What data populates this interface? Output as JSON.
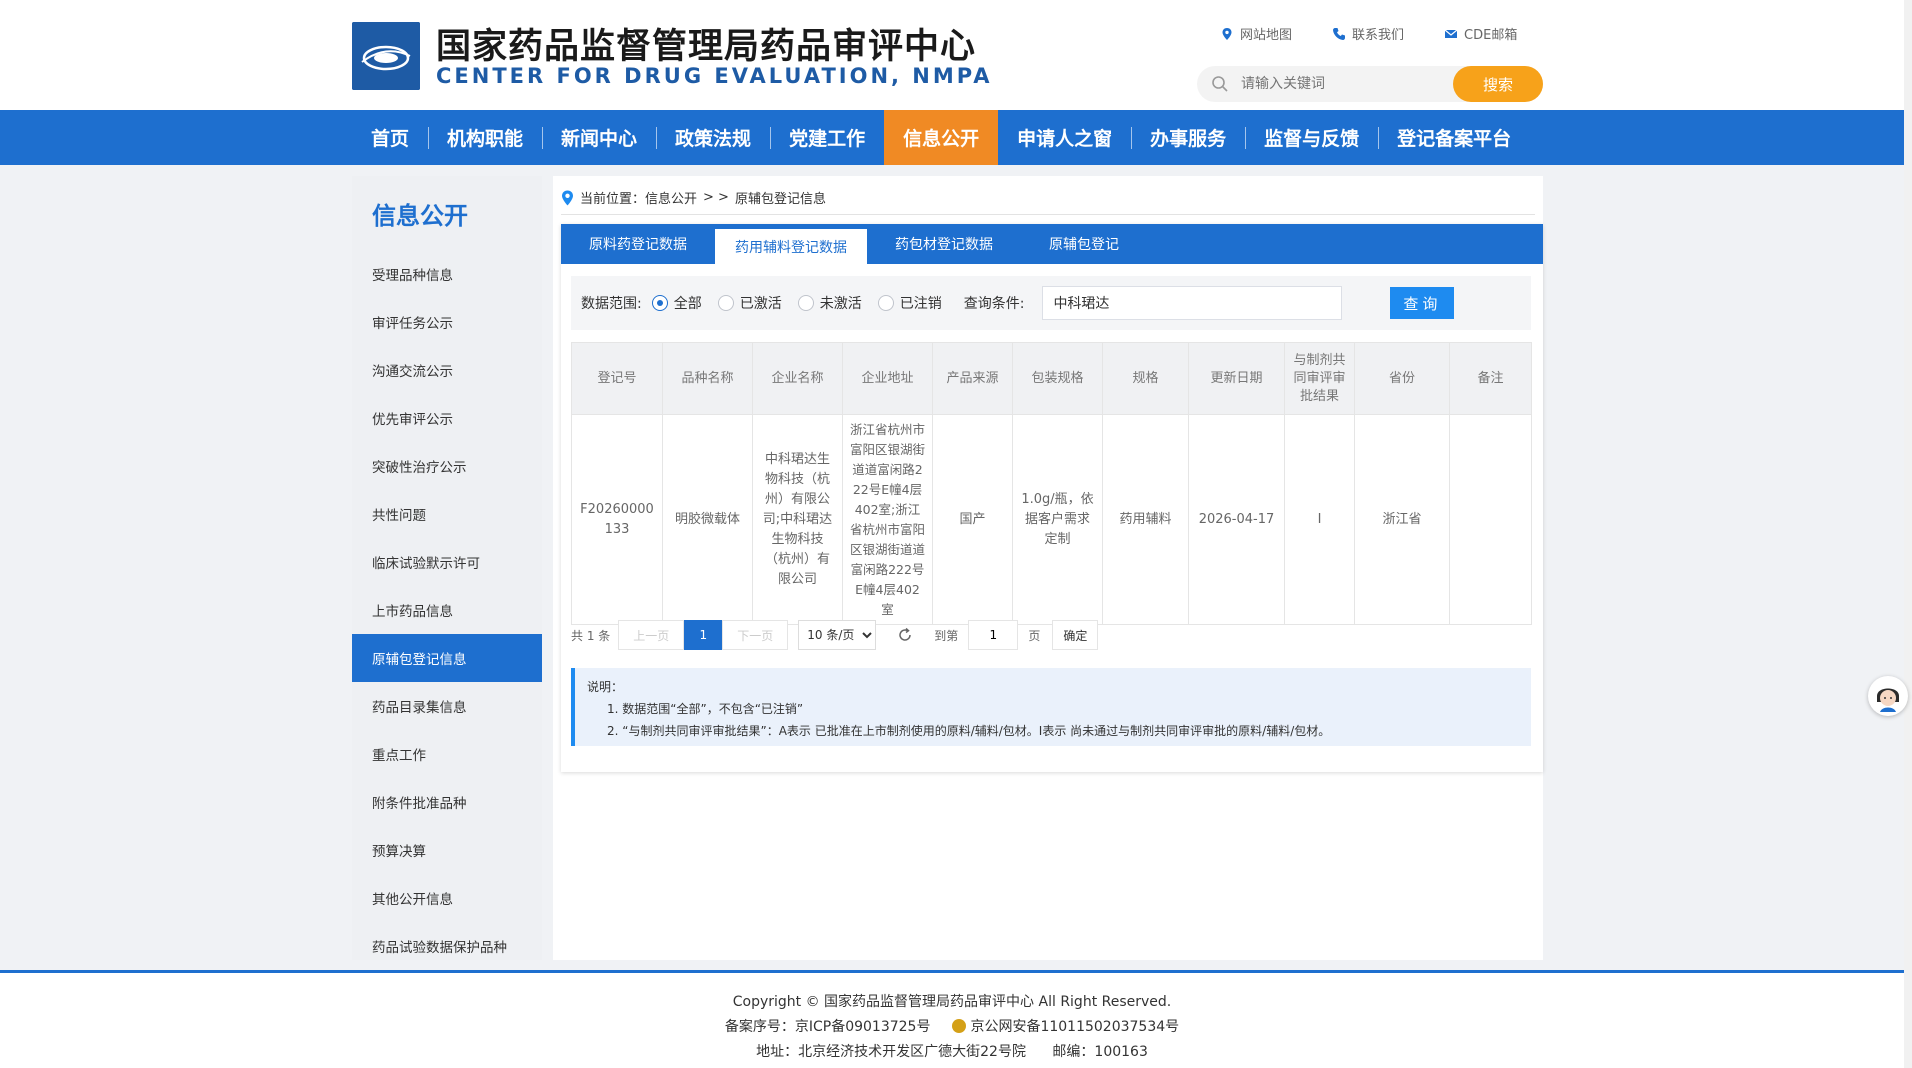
{
  "header": {
    "title_cn": "国家药品监督管理局药品审评中心",
    "title_en": "CENTER FOR DRUG EVALUATION, NMPA",
    "links": [
      "网站地图",
      "联系我们",
      "CDE邮箱"
    ],
    "search_placeholder": "请输入关键词",
    "search_button": "搜索"
  },
  "nav": [
    "首页",
    "机构职能",
    "新闻中心",
    "政策法规",
    "党建工作",
    "信息公开",
    "申请人之窗",
    "办事服务",
    "监督与反馈",
    "登记备案平台"
  ],
  "sidebar": {
    "title": "信息公开",
    "items": [
      "受理品种信息",
      "审评任务公示",
      "沟通交流公示",
      "优先审评公示",
      "突破性治疗公示",
      "共性问题",
      "临床试验默示许可",
      "上市药品信息",
      "原辅包登记信息",
      "药品目录集信息",
      "重点工作",
      "附条件批准品种",
      "预算决算",
      "其他公开信息",
      "药品试验数据保护品种"
    ]
  },
  "breadcrumb": {
    "prefix": "当前位置：信息公开",
    "sep": "> >",
    "current": "原辅包登记信息"
  },
  "tabs": [
    "原料药登记数据",
    "药用辅料登记数据",
    "药包材登记数据",
    "原辅包登记"
  ],
  "filter": {
    "scope_label": "数据范围:",
    "options": [
      "全部",
      "已激活",
      "未激活",
      "已注销"
    ],
    "query_label": "查询条件:",
    "query_value": "中科珺达",
    "query_button": "查询"
  },
  "table": {
    "headers": [
      "登记号",
      "品种名称",
      "企业名称",
      "企业地址",
      "产品来源",
      "包装规格",
      "规格",
      "更新日期",
      "与制剂共同审评审批结果",
      "省份",
      "备注"
    ],
    "rows": [
      [
        "F20260000133",
        "明胶微载体",
        "中科珺达生物科技（杭州）有限公司;中科珺达生物科技（杭州）有限公司",
        "浙江省杭州市富阳区银湖街道道富闲路222号E幢4层402室;浙江省杭州市富阳区银湖街道道富闲路222号E幢4层402室",
        "国产",
        "1.0g/瓶，依据客户需求定制",
        "药用辅料",
        "2026-04-17",
        "I",
        "浙江省",
        ""
      ]
    ]
  },
  "pager": {
    "total": "共 1 条",
    "prev": "上一页",
    "current_page": "1",
    "next": "下一页",
    "page_size": "10 条/页",
    "goto_label": "到第",
    "goto_value": "1",
    "page_unit": "页",
    "confirm": "确定"
  },
  "notes": {
    "title": "说明：",
    "items": [
      "1. 数据范围“全部”，不包含“已注销”",
      "2. “与制剂共同审评审批结果”：A表示 已批准在上市制剂使用的原料/辅料/包材。I表示 尚未通过与制剂共同审评审批的原料/辅料/包材。"
    ]
  },
  "footer": {
    "copyright": "Copyright © 国家药品监督管理局药品审评中心   All Right Reserved.",
    "icp": "备案序号：京ICP备09013725号",
    "police": "京公网安备11011502037534号",
    "address": "地址：北京经济技术开发区广德大街22号院",
    "postcode": "邮编：100163"
  },
  "colors": {
    "primary": "#1e6fcf",
    "accent": "#f08a24",
    "search_button": "#f7a21a"
  }
}
